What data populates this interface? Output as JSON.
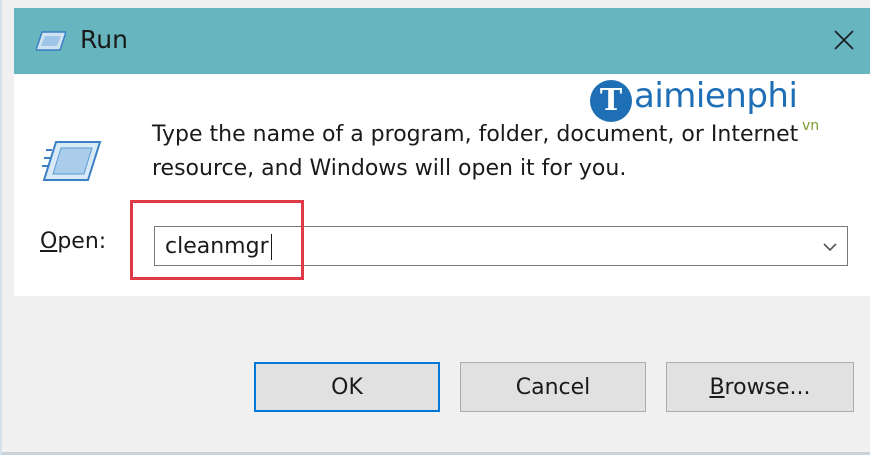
{
  "window": {
    "title": "Run",
    "title_icon": "run-icon",
    "close_icon": "close-icon",
    "titlebar_color": "#66b5bf"
  },
  "watermark": {
    "letter": "T",
    "text": "aimienphi",
    "suffix": "vn",
    "color": "#1f6fb7"
  },
  "dialog": {
    "icon": "run-icon",
    "description": "Type the name of a program, folder, document, or Internet resource, and Windows will open it for you.",
    "open_label_accel": "O",
    "open_label_rest": "pen:",
    "open_value": "cleanmgr",
    "dropdown_icon": "chevron-down-icon",
    "highlight_color": "#e03a48"
  },
  "buttons": {
    "ok": "OK",
    "cancel": "Cancel",
    "browse_accel": "B",
    "browse_rest": "rowse..."
  },
  "colors": {
    "accent": "#0078d7",
    "button_face": "#e1e1e1",
    "footer": "#f0f0f0"
  }
}
